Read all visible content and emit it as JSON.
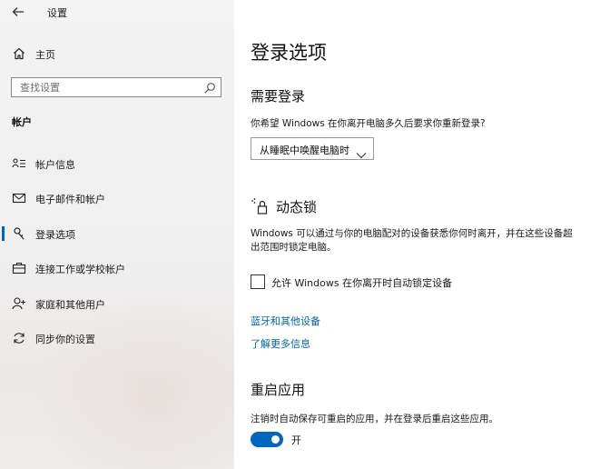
{
  "window": {
    "title": "设置"
  },
  "sidebar": {
    "home_label": "主页",
    "search_placeholder": "查找设置",
    "section_heading": "帐户",
    "items": [
      {
        "label": "帐户信息",
        "icon": "account-info-icon",
        "active": false
      },
      {
        "label": "电子邮件和帐户",
        "icon": "mail-icon",
        "active": false
      },
      {
        "label": "登录选项",
        "icon": "key-icon",
        "active": true
      },
      {
        "label": "连接工作或学校帐户",
        "icon": "briefcase-icon",
        "active": false
      },
      {
        "label": "家庭和其他用户",
        "icon": "person-add-icon",
        "active": false
      },
      {
        "label": "同步你的设置",
        "icon": "sync-icon",
        "active": false
      }
    ]
  },
  "main": {
    "page_title": "登录选项",
    "require_signin": {
      "heading": "需要登录",
      "question": "你希望 Windows 在你离开电脑多久后要求你重新登录?",
      "dropdown_value": "从睡眠中唤醒电脑时"
    },
    "dynamic_lock": {
      "heading": "动态锁",
      "description": "Windows 可以通过与你的电脑配对的设备获悉你何时离开，并在这些设备超出范围时锁定电脑。",
      "checkbox_label": "允许 Windows 在你离开时自动锁定设备",
      "checked": false,
      "links": [
        "蓝牙和其他设备",
        "了解更多信息"
      ]
    },
    "restart_apps": {
      "heading": "重启应用",
      "description": "注销时自动保存可重启的应用，并在登录后重启这些应用。",
      "toggle_state": "开",
      "toggle_on": true
    }
  },
  "colors": {
    "accent": "#0067c0",
    "link": "#0063b1",
    "sidebar_bg": "#f0f0f0"
  }
}
